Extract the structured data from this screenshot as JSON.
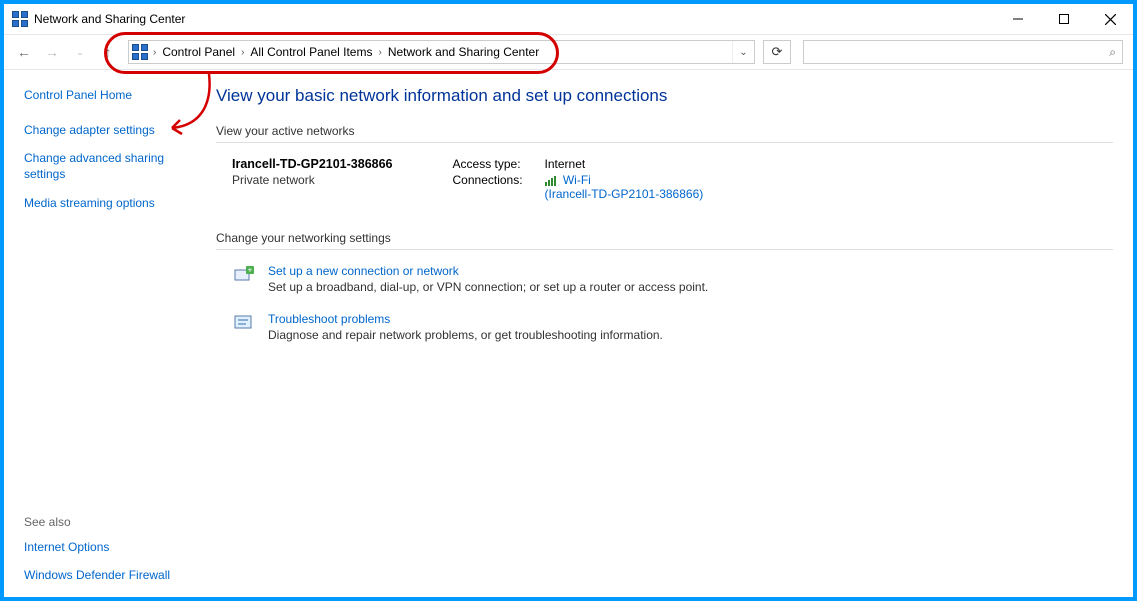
{
  "window": {
    "title": "Network and Sharing Center"
  },
  "breadcrumbs": {
    "item0": "Control Panel",
    "item1": "All Control Panel Items",
    "item2": "Network and Sharing Center"
  },
  "sidebar": {
    "home": "Control Panel Home",
    "link0": "Change adapter settings",
    "link1": "Change advanced sharing settings",
    "link2": "Media streaming options",
    "seealso_heading": "See also",
    "seealso0": "Internet Options",
    "seealso1": "Windows Defender Firewall"
  },
  "main": {
    "title": "View your basic network information and set up connections",
    "active_heading": "View your active networks",
    "network": {
      "name": "Irancell-TD-GP2101-386866",
      "type": "Private network",
      "access_label": "Access type:",
      "access_value": "Internet",
      "conn_label": "Connections:",
      "conn_link": "Wi-Fi",
      "conn_detail": "(Irancell-TD-GP2101-386866)"
    },
    "change_heading": "Change your networking settings",
    "opt0": {
      "link": "Set up a new connection or network",
      "desc": "Set up a broadband, dial-up, or VPN connection; or set up a router or access point."
    },
    "opt1": {
      "link": "Troubleshoot problems",
      "desc": "Diagnose and repair network problems, or get troubleshooting information."
    }
  }
}
